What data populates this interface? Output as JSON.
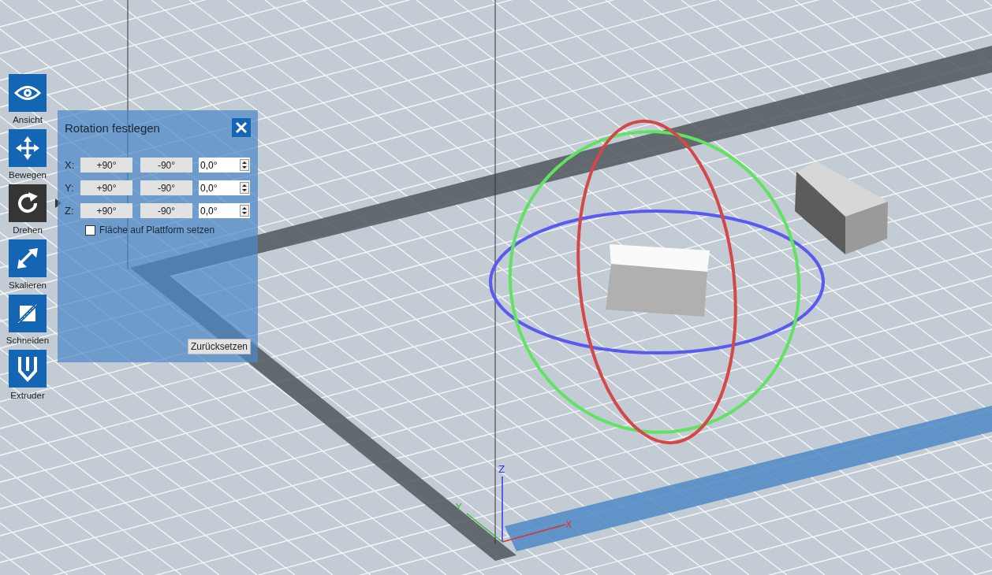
{
  "toolbar": [
    {
      "label": "Ansicht",
      "kind": "eye",
      "selected": false
    },
    {
      "label": "Bewegen",
      "kind": "move",
      "selected": false
    },
    {
      "label": "Drehen",
      "kind": "rotate",
      "selected": true
    },
    {
      "label": "Skalieren",
      "kind": "scale",
      "selected": false
    },
    {
      "label": "Schneiden",
      "kind": "cut",
      "selected": false
    },
    {
      "label": "Extruder",
      "kind": "extruder",
      "selected": false
    }
  ],
  "panel": {
    "title": "Rotation festlegen",
    "rows": [
      {
        "axis": "X:",
        "plus": "+90°",
        "minus": "-90°",
        "value": "0,0°"
      },
      {
        "axis": "Y:",
        "plus": "+90°",
        "minus": "-90°",
        "value": "0,0°"
      },
      {
        "axis": "Z:",
        "plus": "+90°",
        "minus": "-90°",
        "value": "0,0°"
      }
    ],
    "checkbox": {
      "label": "Fläche auf Plattform setzen",
      "checked": false
    },
    "reset": "Zurücksetzen"
  },
  "axes": {
    "x": "X",
    "y": "Y",
    "z": "Z"
  }
}
